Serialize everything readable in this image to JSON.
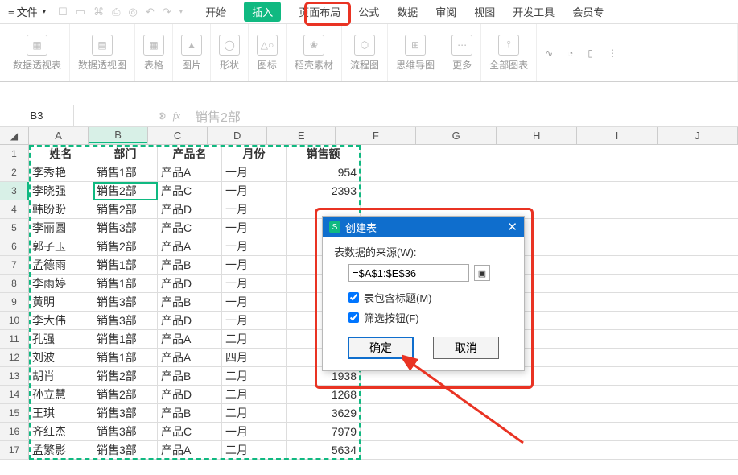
{
  "menubar": {
    "file": "文件",
    "tabs": [
      "开始",
      "插入",
      "页面布局",
      "公式",
      "数据",
      "审阅",
      "视图",
      "开发工具",
      "会员专"
    ],
    "activeTab": "插入"
  },
  "ribbon": [
    {
      "name": "pivot-table",
      "label": "数据透视表"
    },
    {
      "name": "pivot-chart",
      "label": "数据透视图"
    },
    {
      "name": "table",
      "label": "表格"
    },
    {
      "name": "pictures",
      "label": "图片"
    },
    {
      "name": "shapes",
      "label": "形状"
    },
    {
      "name": "icons",
      "label": "图标"
    },
    {
      "name": "docer",
      "label": "稻壳素材"
    },
    {
      "name": "flowchart",
      "label": "流程图"
    },
    {
      "name": "mindmap",
      "label": "思维导图"
    },
    {
      "name": "more",
      "label": "更多"
    },
    {
      "name": "all-charts",
      "label": "全部图表"
    }
  ],
  "formulaBar": {
    "cellRef": "B3",
    "content": "销售2部"
  },
  "grid": {
    "columns": [
      "A",
      "B",
      "C",
      "D",
      "E",
      "F",
      "G",
      "H",
      "I",
      "J"
    ],
    "selectedCol": "B",
    "selectedRow": 3,
    "headers": [
      "姓名",
      "部门",
      "产品名",
      "月份",
      "销售额"
    ],
    "rows": [
      {
        "n": 2,
        "c": [
          "李秀艳",
          "销售1部",
          "产品A",
          "一月",
          "954"
        ]
      },
      {
        "n": 3,
        "c": [
          "李晓强",
          "销售2部",
          "产品C",
          "一月",
          "2393"
        ]
      },
      {
        "n": 4,
        "c": [
          "韩盼盼",
          "销售2部",
          "产品D",
          "一月",
          ""
        ]
      },
      {
        "n": 5,
        "c": [
          "李丽圆",
          "销售3部",
          "产品C",
          "一月",
          ""
        ]
      },
      {
        "n": 6,
        "c": [
          "郭子玉",
          "销售2部",
          "产品A",
          "一月",
          ""
        ]
      },
      {
        "n": 7,
        "c": [
          "孟德雨",
          "销售1部",
          "产品B",
          "一月",
          ""
        ]
      },
      {
        "n": 8,
        "c": [
          "李雨婷",
          "销售1部",
          "产品D",
          "一月",
          ""
        ]
      },
      {
        "n": 9,
        "c": [
          "黄明",
          "销售3部",
          "产品B",
          "一月",
          ""
        ]
      },
      {
        "n": 10,
        "c": [
          "李大伟",
          "销售3部",
          "产品D",
          "一月",
          ""
        ]
      },
      {
        "n": 11,
        "c": [
          "孔强",
          "销售1部",
          "产品A",
          "二月",
          ""
        ]
      },
      {
        "n": 12,
        "c": [
          "刘波",
          "销售1部",
          "产品A",
          "四月",
          ""
        ]
      },
      {
        "n": 13,
        "c": [
          "胡肖",
          "销售2部",
          "产品B",
          "二月",
          "1938"
        ]
      },
      {
        "n": 14,
        "c": [
          "孙立慧",
          "销售2部",
          "产品D",
          "二月",
          "1268"
        ]
      },
      {
        "n": 15,
        "c": [
          "王琪",
          "销售3部",
          "产品B",
          "二月",
          "3629"
        ]
      },
      {
        "n": 16,
        "c": [
          "齐红杰",
          "销售3部",
          "产品C",
          "一月",
          "7979"
        ]
      },
      {
        "n": 17,
        "c": [
          "孟繁影",
          "销售3部",
          "产品A",
          "二月",
          "5634"
        ]
      }
    ],
    "selectionRange": "A1:E36",
    "activeCell": "B3"
  },
  "dialog": {
    "title": "创建表",
    "sourceLabel": "表数据的来源(W):",
    "sourceValue": "=$A$1:$E$36",
    "chk1": "表包含标题(M)",
    "chk1Checked": true,
    "chk2": "筛选按钮(F)",
    "chk2Checked": true,
    "ok": "确定",
    "cancel": "取消"
  }
}
